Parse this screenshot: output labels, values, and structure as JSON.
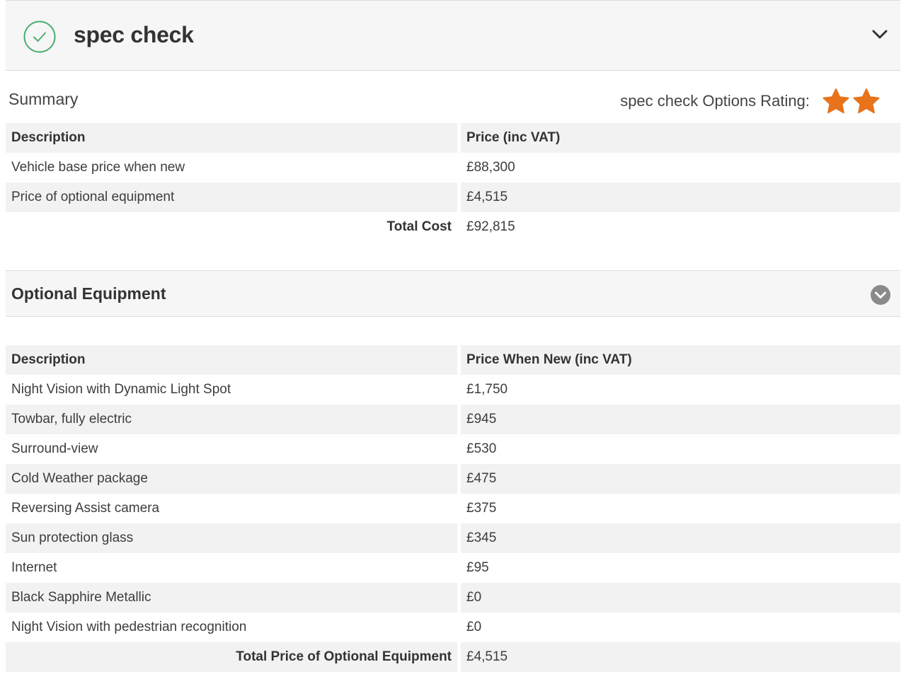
{
  "header": {
    "title": "spec check",
    "status_icon": "check-circle-icon",
    "toggle_icon": "chevron-down-icon"
  },
  "summary": {
    "label": "Summary",
    "rating_label": "spec check Options Rating:",
    "rating_stars": 2,
    "star_color": "#e8731a",
    "columns": [
      "Description",
      "Price (inc VAT)"
    ],
    "rows": [
      {
        "description": "Vehicle base price when new",
        "price": "£88,300"
      },
      {
        "description": "Price of optional equipment",
        "price": "£4,515"
      }
    ],
    "total_label": "Total Cost",
    "total_value": "£92,815"
  },
  "optional_equipment": {
    "title": "Optional Equipment",
    "toggle_icon": "chevron-down-circle-icon",
    "columns": [
      "Description",
      "Price When New (inc VAT)"
    ],
    "rows": [
      {
        "description": "Night Vision with Dynamic Light Spot",
        "price": "£1,750"
      },
      {
        "description": "Towbar, fully electric",
        "price": "£945"
      },
      {
        "description": "Surround-view",
        "price": "£530"
      },
      {
        "description": "Cold Weather package",
        "price": "£475"
      },
      {
        "description": "Reversing Assist camera",
        "price": "£375"
      },
      {
        "description": "Sun protection glass",
        "price": "£345"
      },
      {
        "description": "Internet",
        "price": "£95"
      },
      {
        "description": "Black Sapphire Metallic",
        "price": "£0"
      },
      {
        "description": "Night Vision with pedestrian recognition",
        "price": "£0"
      }
    ],
    "total_label": "Total Price of Optional Equipment",
    "total_value": "£4,515"
  },
  "colors": {
    "check_green": "#4caf6e",
    "bar_background": "#f6f6f6",
    "row_shade": "#f2f2f2",
    "toggle_grey": "#8a8a8a"
  }
}
